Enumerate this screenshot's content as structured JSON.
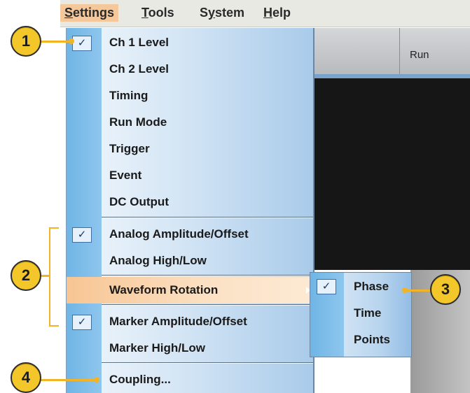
{
  "menubar": {
    "items": [
      {
        "label": "Settings",
        "mnemonic": "S",
        "rest": "ettings",
        "active": true
      },
      {
        "label": "Tools",
        "mnemonic": "T",
        "rest": "ools"
      },
      {
        "label": "System",
        "pre": "S",
        "mnemonic": "y",
        "rest": "stem"
      },
      {
        "label": "Help",
        "mnemonic": "H",
        "rest": "elp"
      }
    ]
  },
  "app": {
    "toolbar_label": "Run"
  },
  "settings_menu": {
    "items": [
      {
        "label": "Ch 1 Level",
        "checked": true
      },
      {
        "label": "Ch 2 Level"
      },
      {
        "label": "Timing"
      },
      {
        "label": "Run Mode"
      },
      {
        "label": "Trigger"
      },
      {
        "label": "Event"
      },
      {
        "label": "DC Output"
      },
      {
        "label": "Analog Amplitude/Offset",
        "checked": true
      },
      {
        "label": "Analog High/Low"
      },
      {
        "label": "Waveform Rotation",
        "highlighted": true,
        "has_submenu": true
      },
      {
        "label": "Marker Amplitude/Offset",
        "checked": true
      },
      {
        "label": "Marker High/Low"
      },
      {
        "label": "Coupling..."
      }
    ]
  },
  "waveform_rotation_submenu": {
    "items": [
      {
        "label": "Phase",
        "checked": true
      },
      {
        "label": "Time"
      },
      {
        "label": "Points"
      }
    ]
  },
  "callouts": [
    "1",
    "2",
    "3",
    "4"
  ],
  "colors": {
    "callout": "#f3c72a",
    "highlight": "#f7c593",
    "gutter": "#6fb5e5"
  }
}
